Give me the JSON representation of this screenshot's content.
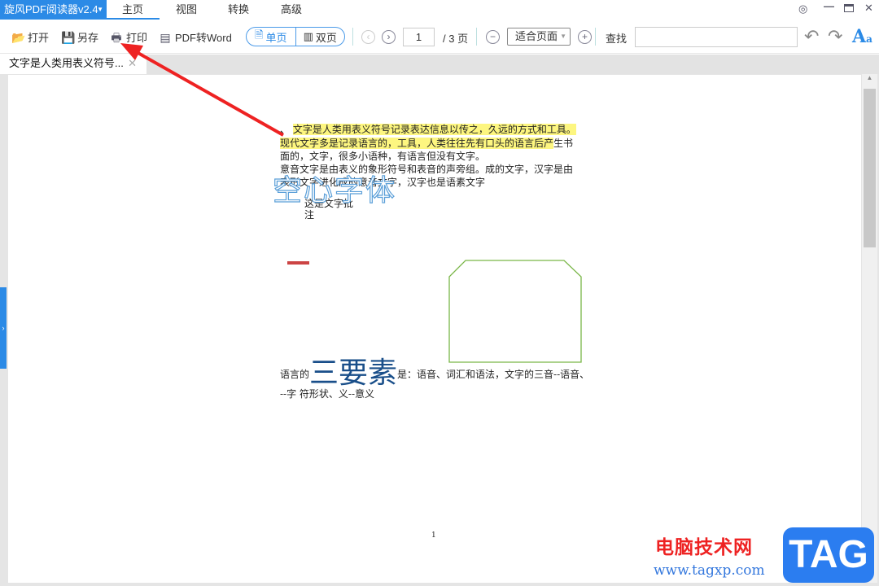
{
  "app": {
    "title": "旋风PDF阅读器v2.4"
  },
  "menu": [
    "主页",
    "视图",
    "转换",
    "高级"
  ],
  "toolbar": {
    "open": "打开",
    "save_as": "另存",
    "print": "打印",
    "to_word": "PDF转Word",
    "single": "单页",
    "double": "双页",
    "page_current": "1",
    "page_total": "/ 3 页",
    "zoom_value": "适合页面",
    "find_label": "查找",
    "find_value": ""
  },
  "tab": {
    "title": "文字是人类用表义符号..."
  },
  "doc": {
    "lines": [
      "、",
      "文字是人类用表义符号记录表达信息以传之，久远的方式和工具。",
      "现代文字多是记录语言的，工具，人类往往先有口头的语言后产",
      "生书",
      "面的，文字，很多小语种，有语言但没有文字。",
      "意音文字是由表义的象形符号和表音的声旁组。成的文字，汉字是由",
      "表形文字进化成的意音文字，汉字也是语素文字"
    ],
    "annotation": [
      "这是文字批",
      "注"
    ],
    "hollow": "空心字体",
    "line3_pre": "语言的",
    "line3_big": "三要素",
    "line3_post": "是：语音、词汇和语法，文字的三音--语音、",
    "line4": "--字  符形状、义--意义",
    "page_number": "1"
  },
  "watermark": {
    "site": "电脑技术网",
    "url": "www.tagxp.com",
    "logo": "TAG"
  },
  "colors": {
    "accent": "#2b8ae6",
    "highlight": "#fdf680",
    "shape": "#7ab648",
    "arrow": "#ee2222"
  }
}
